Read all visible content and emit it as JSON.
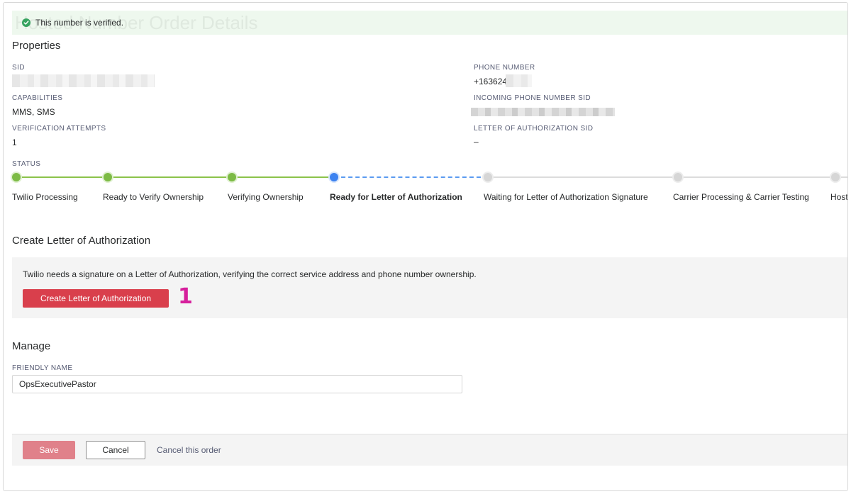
{
  "page": {
    "ghost_title": "Hosted Number Order Details"
  },
  "banner": {
    "message": "This number is verified.",
    "icon": "check-circle-icon"
  },
  "properties": {
    "title": "Properties",
    "sid_label": "SID",
    "phone_label": "PHONE NUMBER",
    "phone_value": "+163624",
    "capabilities_label": "CAPABILITIES",
    "capabilities_value": "MMS, SMS",
    "incoming_sid_label": "INCOMING PHONE NUMBER SID",
    "verification_label": "VERIFICATION ATTEMPTS",
    "verification_value": "1",
    "loa_sid_label": "LETTER OF AUTHORIZATION SID",
    "loa_sid_value": "–"
  },
  "status": {
    "label": "STATUS",
    "steps": [
      {
        "label": "Twilio Processing",
        "state": "done"
      },
      {
        "label": "Ready to Verify Ownership",
        "state": "done"
      },
      {
        "label": "Verifying Ownership",
        "state": "done"
      },
      {
        "label": "Ready for Letter of Authorization",
        "state": "current"
      },
      {
        "label": "Waiting for Letter of Authorization Signature",
        "state": "todo"
      },
      {
        "label": "Carrier Processing & Carrier Testing",
        "state": "todo"
      },
      {
        "label": "Hosted",
        "state": "todo"
      }
    ],
    "colors": {
      "done": "#7dbb45",
      "current": "#3c82f0",
      "todo": "#d6d6d6"
    }
  },
  "loa": {
    "title": "Create Letter of Authorization",
    "description": "Twilio needs a signature on a Letter of Authorization, verifying the correct service address and phone number ownership.",
    "button_label": "Create Letter of Authorization",
    "annotation": "1"
  },
  "manage": {
    "title": "Manage",
    "friendly_name_label": "FRIENDLY NAME",
    "friendly_name_value": "OpsExecutivePastor"
  },
  "footer": {
    "save_label": "Save",
    "cancel_label": "Cancel",
    "cancel_order_label": "Cancel this order"
  },
  "colors": {
    "primary": "#d93f4c",
    "primary_disabled": "#e0818a",
    "success": "#36a35f"
  }
}
